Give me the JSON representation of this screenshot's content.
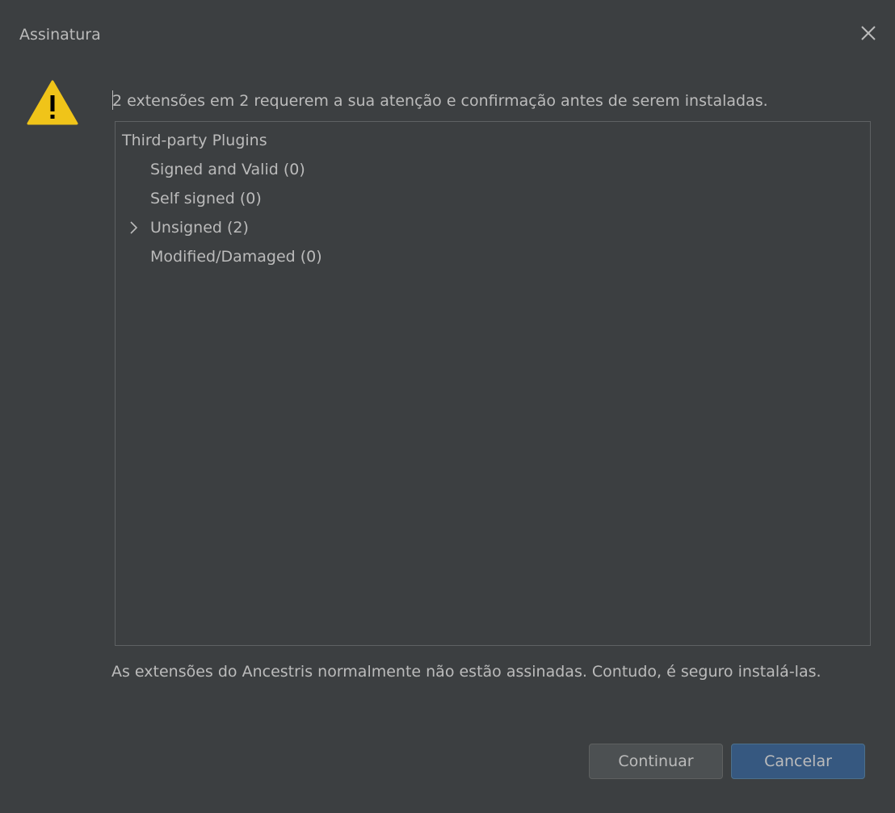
{
  "window": {
    "title": "Assinatura"
  },
  "dialog": {
    "message": "2 extensões em 2 requerem a sua atenção e confirmação antes de serem instaladas.",
    "warning_icon": "warning-triangle-icon",
    "hint": "As extensões do Ancestris normalmente não estão assinadas. Contudo, é seguro instalá-las."
  },
  "tree": {
    "root": "Third-party Plugins",
    "items": [
      {
        "label": "Signed and Valid (0)",
        "expandable": false
      },
      {
        "label": "Self signed (0)",
        "expandable": false
      },
      {
        "label": "Unsigned (2)",
        "expandable": true,
        "expanded": false
      },
      {
        "label": "Modified/Damaged (0)",
        "expandable": false
      }
    ]
  },
  "buttons": {
    "continue": "Continuar",
    "cancel": "Cancelar"
  },
  "colors": {
    "background": "#3c3f41",
    "text": "#bbbbbb",
    "primary_button": "#365880",
    "secondary_button": "#4c5052",
    "warning": "#f0c419"
  }
}
